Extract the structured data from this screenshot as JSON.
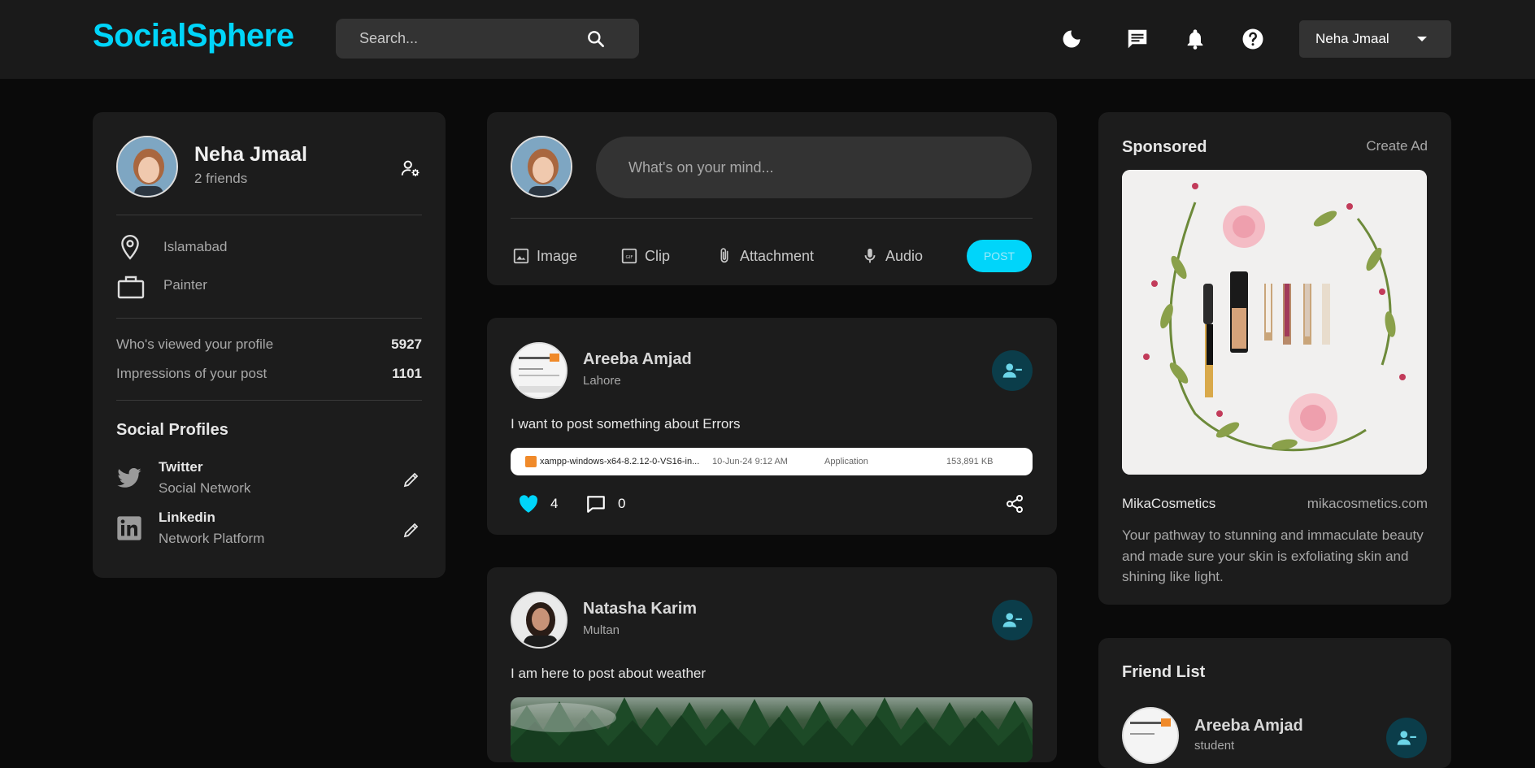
{
  "app": {
    "logo": "SocialSphere",
    "brand_color": "#00d5fa"
  },
  "header": {
    "search_placeholder": "Search...",
    "icons": [
      "moon-icon",
      "chat-icon",
      "bell-icon",
      "help-icon"
    ],
    "user_menu": {
      "label": "Neha Jmaal"
    }
  },
  "profile": {
    "name": "Neha Jmaal",
    "friends": "2 friends",
    "location": "Islamabad",
    "occupation": "Painter",
    "stats": [
      {
        "label": "Who's viewed your profile",
        "value": "5927"
      },
      {
        "label": "Impressions of your post",
        "value": "1101"
      }
    ],
    "social_title": "Social Profiles",
    "socials": [
      {
        "name": "Twitter",
        "sub": "Social Network",
        "icon": "twitter-icon"
      },
      {
        "name": "Linkedin",
        "sub": "Network Platform",
        "icon": "linkedin-icon"
      }
    ]
  },
  "composer": {
    "placeholder": "What's on your mind...",
    "tools": [
      "Image",
      "Clip",
      "Attachment",
      "Audio"
    ],
    "post_label": "POST"
  },
  "posts": [
    {
      "author": "Areeba Amjad",
      "location": "Lahore",
      "text": "I want to post something about Errors",
      "attachment_row": {
        "filename": "xampp-windows-x64-8.2.12-0-VS16-in...",
        "date": "10-Jun-24 9:12 AM",
        "type": "Application",
        "size": "153,891 KB"
      },
      "likes": "4",
      "comments": "0",
      "liked": true
    },
    {
      "author": "Natasha Karim",
      "location": "Multan",
      "text": "I am here to post about weather"
    }
  ],
  "sponsored": {
    "title": "Sponsored",
    "create_ad": "Create Ad",
    "brand": "MikaCosmetics",
    "site": "mikacosmetics.com",
    "description": "Your pathway to stunning and immaculate beauty and made sure your skin is exfoliating skin and shining like light."
  },
  "friend_list": {
    "title": "Friend List",
    "friends": [
      {
        "name": "Areeba Amjad",
        "sub": "student"
      }
    ]
  }
}
